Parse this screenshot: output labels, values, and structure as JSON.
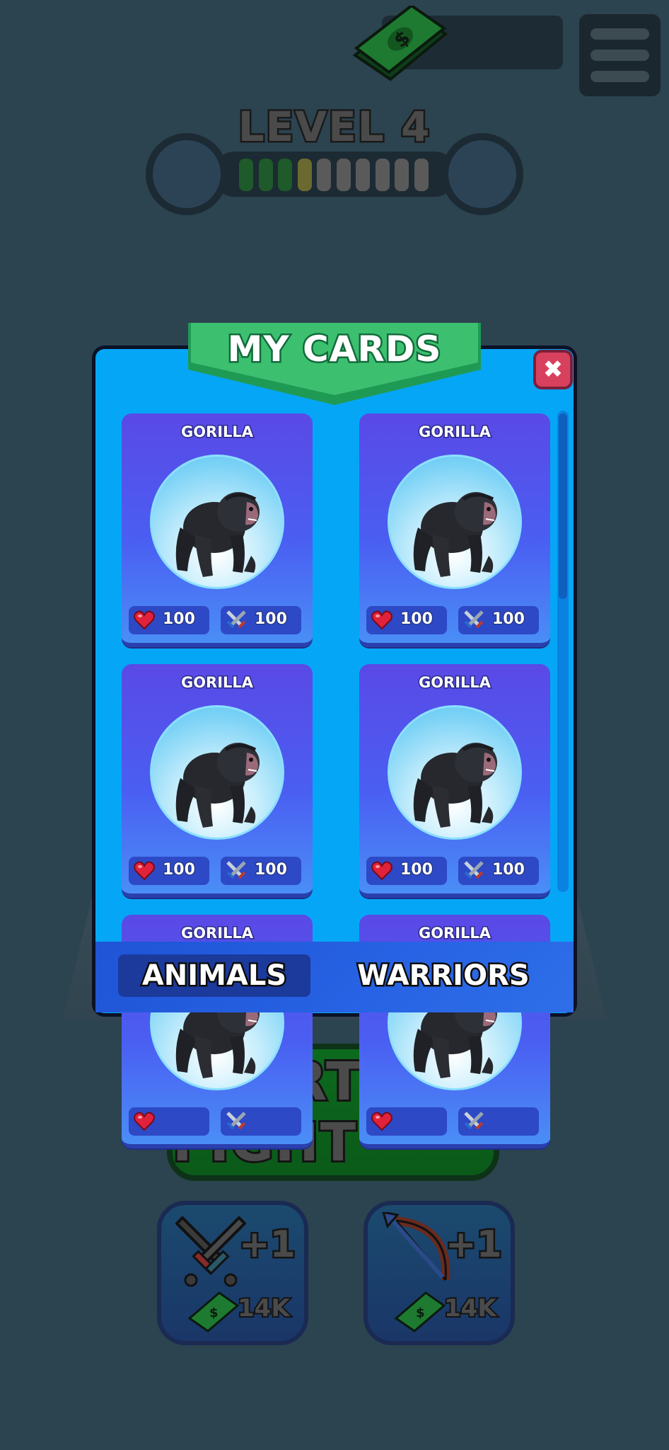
{
  "hud": {
    "cash_value": "",
    "level_title": "LEVEL 4",
    "level_progress": {
      "filled_green": 3,
      "current": 1,
      "empty": 6
    }
  },
  "dialog": {
    "title": "MY CARDS",
    "close_icon": "close-icon",
    "cards": [
      {
        "name": "GORILLA",
        "health": "100",
        "attack": "100"
      },
      {
        "name": "GORILLA",
        "health": "100",
        "attack": "100"
      },
      {
        "name": "GORILLA",
        "health": "100",
        "attack": "100"
      },
      {
        "name": "GORILLA",
        "health": "100",
        "attack": "100"
      },
      {
        "name": "GORILLA",
        "health": "",
        "attack": ""
      },
      {
        "name": "GORILLA",
        "health": "",
        "attack": ""
      }
    ],
    "tabs": [
      {
        "label": "ANIMALS",
        "active": true
      },
      {
        "label": "WARRIORS",
        "active": false
      }
    ]
  },
  "start_button": {
    "label": "START FIGHT"
  },
  "upgrades": [
    {
      "icon": "swords-icon",
      "bonus": "+1",
      "cost": "14K"
    },
    {
      "icon": "bow-icon",
      "bonus": "+1",
      "cost": "14K"
    }
  ],
  "colors": {
    "background": "#2c4350",
    "dialog": "#06a6f6",
    "ribbon": "#3cc070",
    "card": "#5a49e6",
    "close": "#d8415e"
  }
}
